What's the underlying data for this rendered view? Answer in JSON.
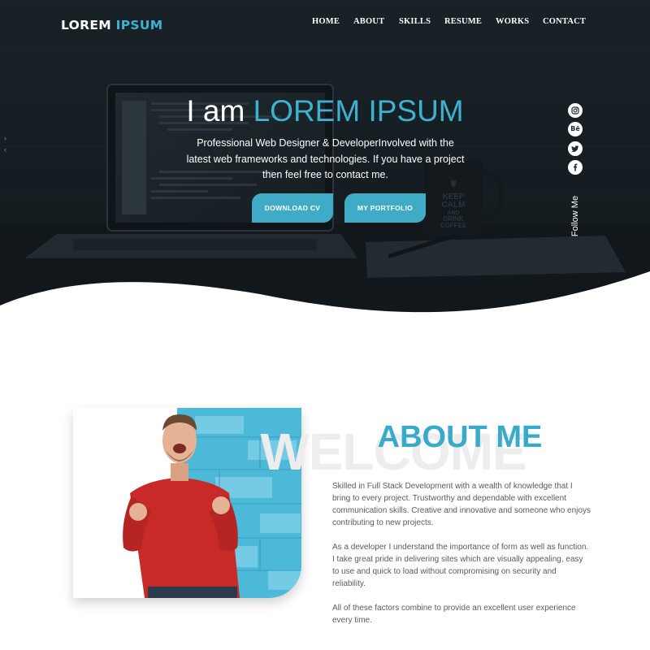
{
  "brand": {
    "first": "LOREM",
    "second": "IPSUM",
    "accent_color": "#3fb1d0"
  },
  "nav": {
    "items": [
      "HOME",
      "ABOUT",
      "SKILLS",
      "RESUME",
      "WORKS",
      "CONTACT"
    ]
  },
  "hero": {
    "title_prefix": "I am",
    "title_name": "LOREM IPSUM",
    "subtitle": "Professional Web Designer & DeveloperInvolved with the latest web frameworks and technologies. If you have a project then feel free to contact me.",
    "buttons": {
      "download_cv": "DOWNLOAD CV",
      "portfolio": "MY PORTFOLIO"
    },
    "mug_text": [
      "KEEP",
      "CALM",
      "AND",
      "DRINK",
      "COFFEE"
    ]
  },
  "social": {
    "icons": [
      "instagram-icon",
      "behance-icon",
      "twitter-icon",
      "facebook-icon"
    ],
    "behance_label": "Bē",
    "follow_label": "Follow Me"
  },
  "slider": {
    "arrows": [
      "chevron-right-icon",
      "chevron-left-icon"
    ]
  },
  "about": {
    "background_word": "WELCOME",
    "title": "ABOUT ME",
    "paragraphs": [
      "Skilled in Full Stack Development with a wealth of knowledge that I bring to every project. Trustworthy and dependable with excellent communication skills. Creative and innovative and someone who enjoys contributing to new projects.",
      "As a developer I understand the importance of form as well as function. I take great pride in delivering sites which are visually appealing, easy to use and quick to load without compromising on security and reliability.",
      "All of these factors combine to provide an excellent user experience every time."
    ]
  },
  "colors": {
    "accent": "#3fb1d0",
    "hero_dark": "#1b2328",
    "body_text": "#555c61",
    "button": "#40abc7"
  }
}
